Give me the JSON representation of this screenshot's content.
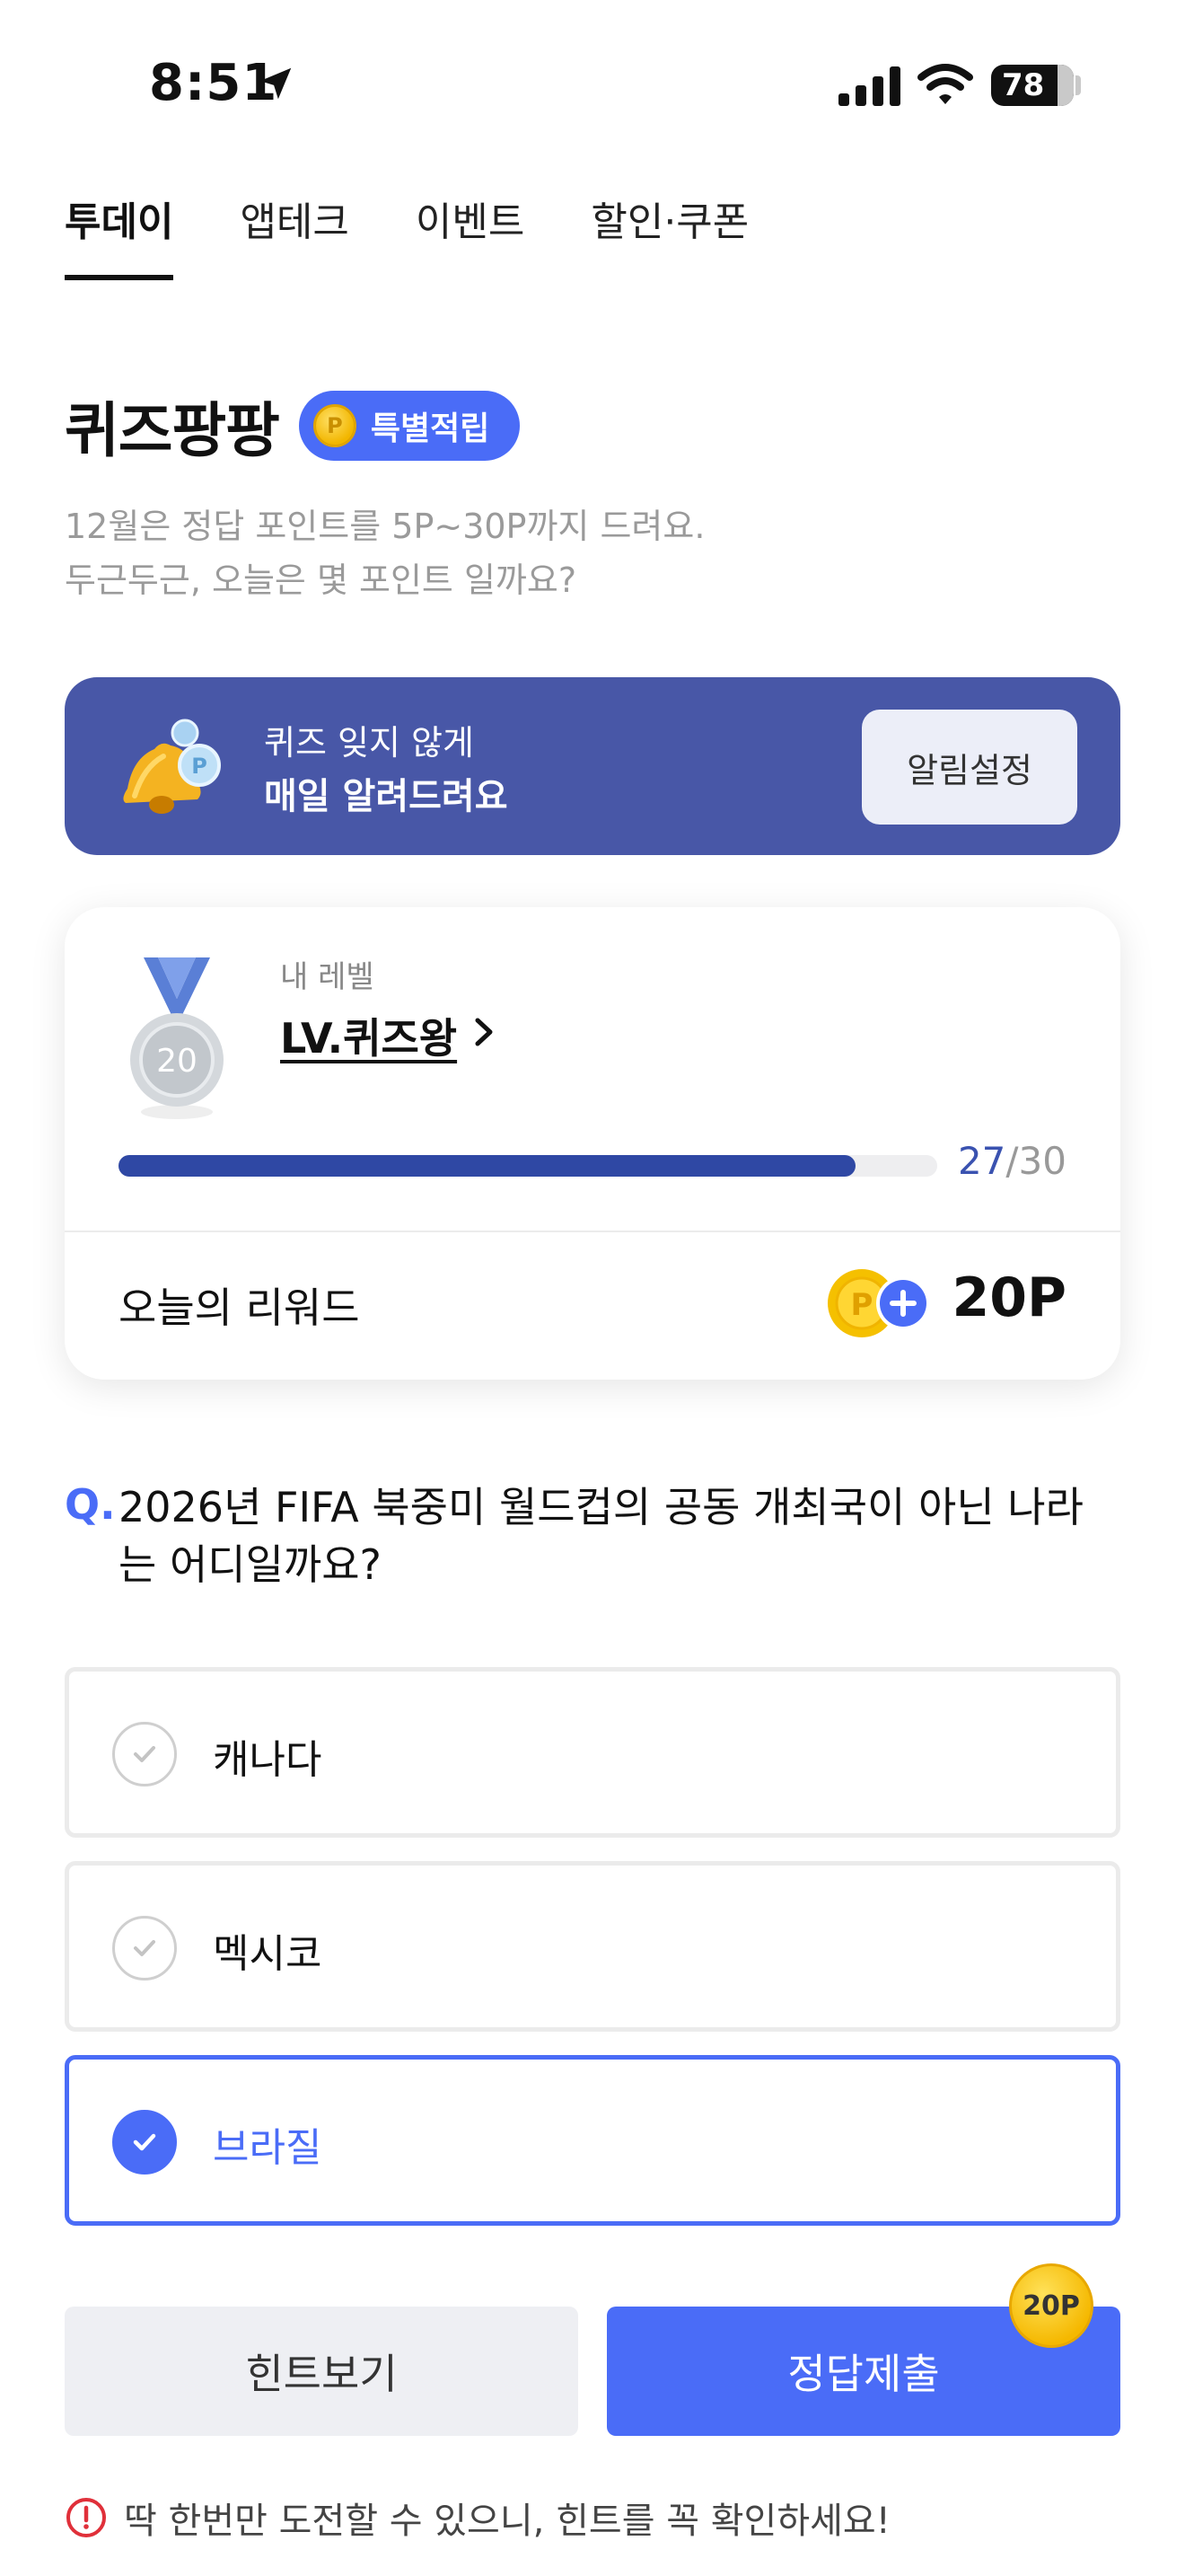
{
  "status_bar": {
    "time": "8:51",
    "battery": "78"
  },
  "tabs": [
    {
      "label": "투데이",
      "active": true
    },
    {
      "label": "앱테크",
      "active": false
    },
    {
      "label": "이벤트",
      "active": false
    },
    {
      "label": "할인·쿠폰",
      "active": false
    }
  ],
  "header": {
    "title": "퀴즈팡팡",
    "badge": "특별적립",
    "badge_coin": "P",
    "desc_line1": "12월은 정답 포인트를 5P~30P까지 드려요.",
    "desc_line2": "두근두근, 오늘은 몇 포인트 일까요?"
  },
  "notify_banner": {
    "line1": "퀴즈 잊지 않게",
    "line2": "매일 알려드려요",
    "button": "알림설정"
  },
  "level_card": {
    "medal_number": "20",
    "label": "내 레벨",
    "level_name": "LV.퀴즈왕",
    "progress_current": "27",
    "progress_sep_total": "/30",
    "progress_fraction": 0.9,
    "reward_label": "오늘의 리워드",
    "reward_value": "20P"
  },
  "question": {
    "prefix": "Q.",
    "text": "2026년 FIFA 북중미 월드컵의 공동 개최국이 아닌 나라는 어디일까요?"
  },
  "options": [
    {
      "label": "캐나다",
      "selected": false
    },
    {
      "label": "멕시코",
      "selected": false
    },
    {
      "label": "브라질",
      "selected": true
    }
  ],
  "buttons": {
    "hint": "힌트보기",
    "submit": "정답제출",
    "submit_badge": "20P"
  },
  "warning": "딱 한번만 도전할 수 있으니, 힌트를 꼭 확인하세요!",
  "colors": {
    "accent": "#4a6cf7",
    "banner": "#4857a7",
    "progress": "#2f48a4",
    "coin": "#f5b800"
  }
}
